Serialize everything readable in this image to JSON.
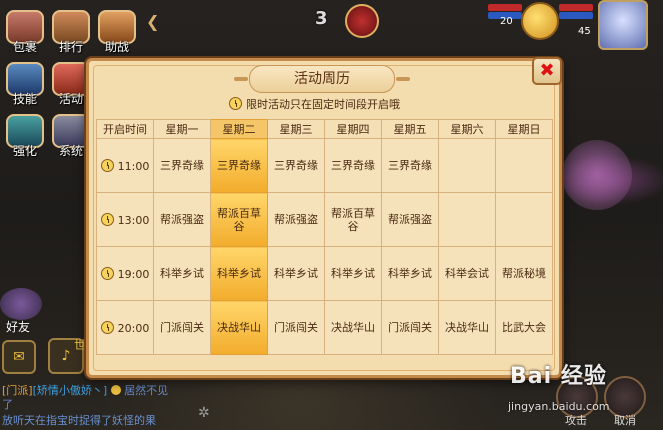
{
  "game_hud": {
    "menu": [
      {
        "label": "包裹"
      },
      {
        "label": "排行"
      },
      {
        "label": "助战"
      },
      {
        "label": "技能"
      },
      {
        "label": "活动"
      },
      {
        "label": "强化"
      },
      {
        "label": "系统"
      }
    ],
    "counter": "3",
    "player_left_level": "20",
    "player_right_level": "45",
    "friends_label": "好友",
    "voice_label": "世",
    "chat": [
      {
        "channel": "[门派]",
        "user": "[矫情小傲娇丶]",
        "text": "居然不见"
      },
      {
        "channel": "",
        "user": "",
        "text": "了"
      },
      {
        "channel": "",
        "user": "",
        "text": "放听天在指宝时捉得了妖怪的果"
      }
    ],
    "right_buttons": {
      "attack": "攻击",
      "cancel": "取消"
    }
  },
  "dialog": {
    "title": "活动周历",
    "notice": "限时活动只在固定时间段开启哦",
    "close_label": "✖",
    "headers": [
      "开启时间",
      "星期一",
      "星期二",
      "星期三",
      "星期四",
      "星期五",
      "星期六",
      "星期日"
    ],
    "today_index": 2,
    "rows": [
      {
        "time": "11:00",
        "cells": [
          "三界奇缘",
          "三界奇缘",
          "三界奇缘",
          "三界奇缘",
          "三界奇缘",
          "",
          ""
        ]
      },
      {
        "time": "13:00",
        "cells": [
          "帮派强盗",
          "帮派百草谷",
          "帮派强盗",
          "帮派百草谷",
          "帮派强盗",
          "",
          ""
        ]
      },
      {
        "time": "19:00",
        "cells": [
          "科举乡试",
          "科举乡试",
          "科举乡试",
          "科举乡试",
          "科举乡试",
          "科举会试",
          "帮派秘境"
        ]
      },
      {
        "time": "20:00",
        "cells": [
          "门派闯关",
          "决战华山",
          "门派闯关",
          "决战华山",
          "门派闯关",
          "决战华山",
          "比武大会"
        ]
      }
    ]
  },
  "watermark": {
    "brand": "Bai 经验",
    "url": "jingyan.baidu.com"
  }
}
